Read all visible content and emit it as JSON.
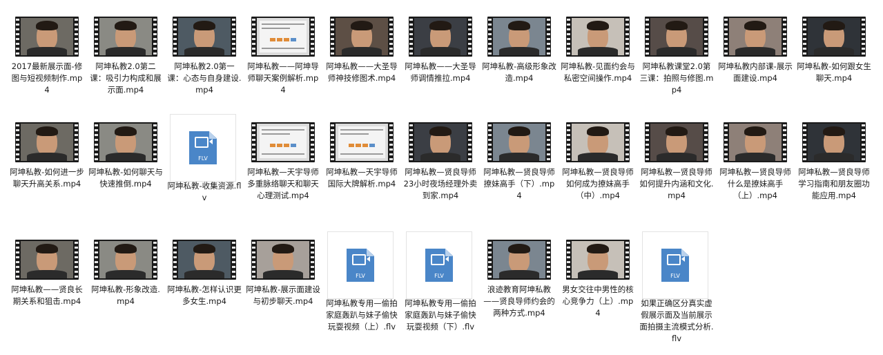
{
  "files": [
    {
      "name": "2017最新展示面-修图与短视频制作.mp4",
      "type": "video"
    },
    {
      "name": "阿坤私教2.0第二课：吸引力构成和展示面.mp4",
      "type": "video"
    },
    {
      "name": "阿坤私教2.0第一课：心态与自身建设.mp4",
      "type": "video"
    },
    {
      "name": "阿坤私教——阿坤导师聊天案例解析.mp4",
      "type": "video"
    },
    {
      "name": "阿坤私教——大圣导师神技修图术.mp4",
      "type": "video"
    },
    {
      "name": "阿坤私教——大圣导师调情推拉.mp4",
      "type": "video"
    },
    {
      "name": "阿坤私教-高级形象改造.mp4",
      "type": "video"
    },
    {
      "name": "阿坤私教-见面约会与私密空间操作.mp4",
      "type": "video"
    },
    {
      "name": "阿坤私教课堂2.0第三课：拍照与修图.mp4",
      "type": "video"
    },
    {
      "name": "阿坤私教内部课-展示面建设.mp4",
      "type": "video"
    },
    {
      "name": "阿坤私教-如何跟女生聊天.mp4",
      "type": "video"
    },
    {
      "name": "阿坤私教-如何进一步聊天升高关系.mp4",
      "type": "video"
    },
    {
      "name": "阿坤私教-如何聊天与快速推倒.mp4",
      "type": "video"
    },
    {
      "name": "阿坤私教-收集资源.flv",
      "type": "flv",
      "ext_label": "FLV"
    },
    {
      "name": "阿坤私教—天宇导师 多重脉络聊天和聊天心理测试.mp4",
      "type": "video"
    },
    {
      "name": "阿坤私教—天宇导师国际大牌解析.mp4",
      "type": "video"
    },
    {
      "name": "阿坤私教—贤良导师23小时夜场经理外卖到家.mp4",
      "type": "video"
    },
    {
      "name": "阿坤私教—贤良导师撩妹高手（下）.mp4",
      "type": "video"
    },
    {
      "name": "阿坤私教—贤良导师如何成为撩妹高手（中）.mp4",
      "type": "video"
    },
    {
      "name": "阿坤私教—贤良导师如何提升内涵和文化.mp4",
      "type": "video"
    },
    {
      "name": "阿坤私教—贤良导师什么是撩妹高手（上）.mp4",
      "type": "video"
    },
    {
      "name": "阿坤私教—贤良导师学习指南和朋友圈功能应用.mp4",
      "type": "video"
    },
    {
      "name": "阿坤私教——贤良长期关系和狙击.mp4",
      "type": "video"
    },
    {
      "name": "阿坤私教-形象改造.mp4",
      "type": "video"
    },
    {
      "name": "阿坤私教-怎样认识更多女生.mp4",
      "type": "video"
    },
    {
      "name": "阿坤私教-展示面建设与初步聊天.mp4",
      "type": "video"
    },
    {
      "name": "阿坤私教专用—偷拍家庭轰趴与妹子偷快玩耍视频（上）.flv",
      "type": "flv",
      "ext_label": "FLV"
    },
    {
      "name": "阿坤私教专用—偷拍家庭轰趴与妹子偷快玩耍视频（下）.flv",
      "type": "flv",
      "ext_label": "FLV"
    },
    {
      "name": "浪迹教育阿坤私教——贤良导师约会的两种方式.mp4",
      "type": "video"
    },
    {
      "name": "男女交往中男性的核心竞争力（上）.mp4",
      "type": "video"
    },
    {
      "name": "如果正确区分真实虚假展示面及当前展示面拍摄主流模式分析.flv",
      "type": "flv",
      "ext_label": "FLV"
    }
  ]
}
